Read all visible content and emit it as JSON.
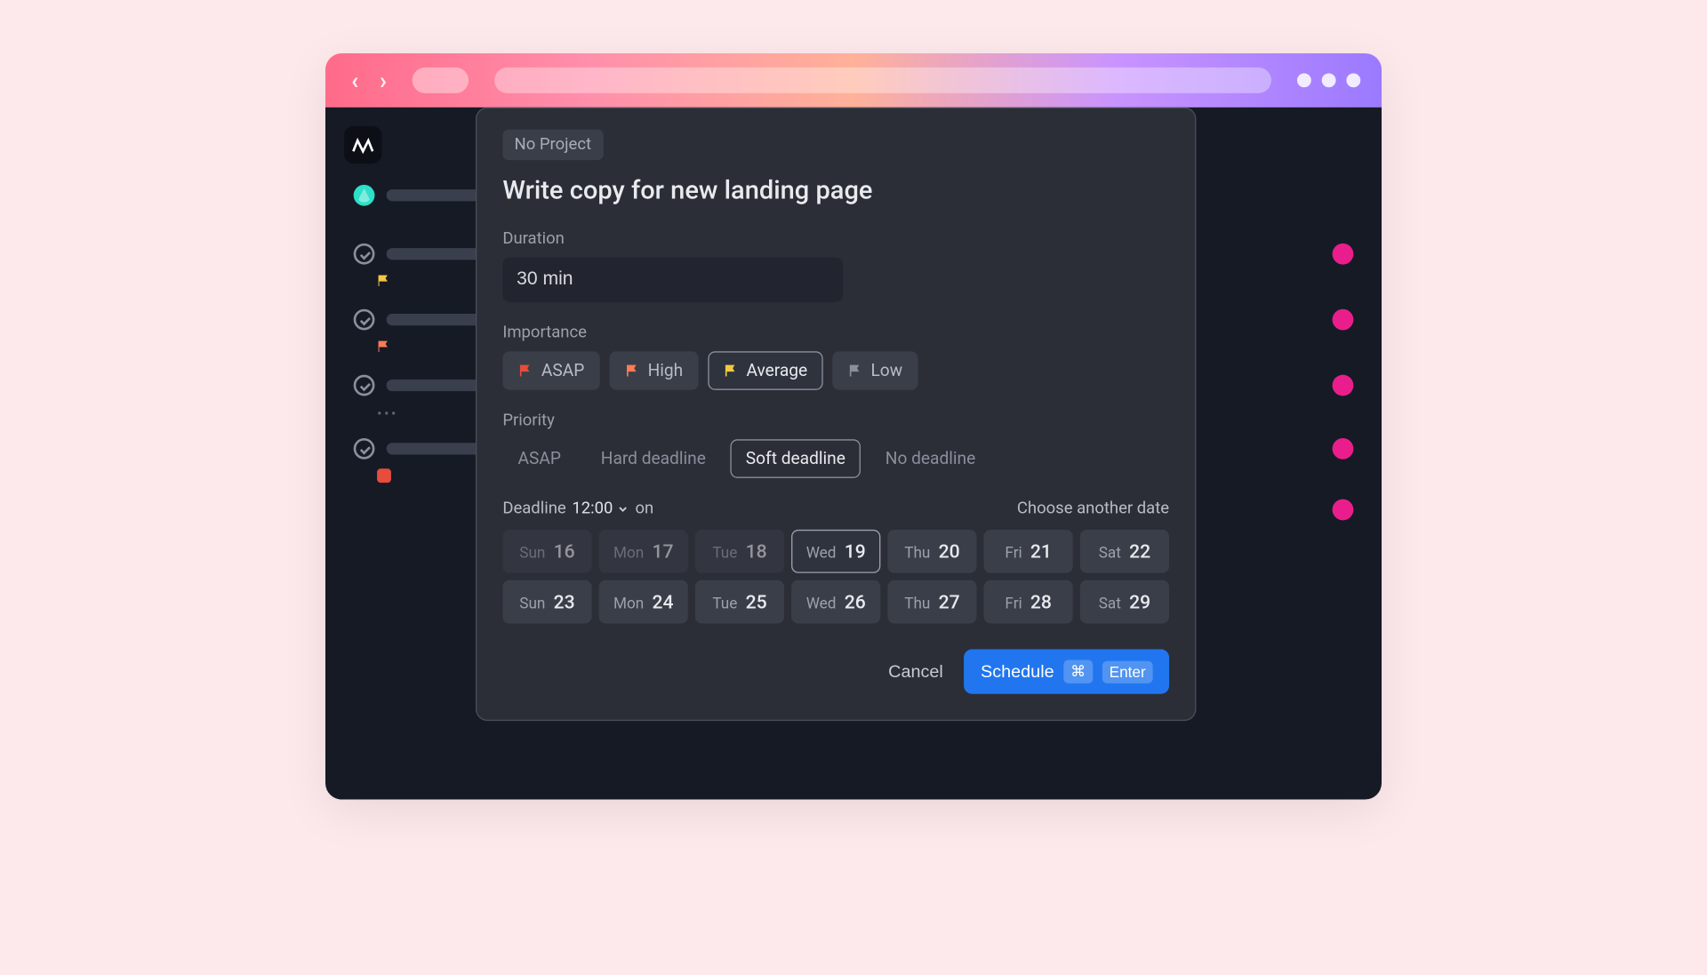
{
  "modal": {
    "project_chip": "No Project",
    "task_title": "Write copy for new landing page",
    "duration_label": "Duration",
    "duration_value": "30 min",
    "importance_label": "Importance",
    "importance_options": [
      {
        "label": "ASAP",
        "color": "#e74c3c",
        "selected": false
      },
      {
        "label": "High",
        "color": "#ff7b54",
        "selected": false
      },
      {
        "label": "Average",
        "color": "#f5c842",
        "selected": true
      },
      {
        "label": "Low",
        "color": "#8a8f9c",
        "selected": false
      }
    ],
    "priority_label": "Priority",
    "priority_options": [
      {
        "label": "ASAP",
        "selected": false
      },
      {
        "label": "Hard deadline",
        "selected": false
      },
      {
        "label": "Soft deadline",
        "selected": true
      },
      {
        "label": "No deadline",
        "selected": false
      }
    ],
    "deadline_prefix": "Deadline",
    "deadline_time": "12:00",
    "deadline_on": "on",
    "choose_another": "Choose another date",
    "dates": [
      {
        "dow": "Sun",
        "num": "16",
        "past": true,
        "selected": false
      },
      {
        "dow": "Mon",
        "num": "17",
        "past": true,
        "selected": false
      },
      {
        "dow": "Tue",
        "num": "18",
        "past": true,
        "selected": false
      },
      {
        "dow": "Wed",
        "num": "19",
        "past": false,
        "selected": true
      },
      {
        "dow": "Thu",
        "num": "20",
        "past": false,
        "selected": false
      },
      {
        "dow": "Fri",
        "num": "21",
        "past": false,
        "selected": false
      },
      {
        "dow": "Sat",
        "num": "22",
        "past": false,
        "selected": false
      },
      {
        "dow": "Sun",
        "num": "23",
        "past": false,
        "selected": false
      },
      {
        "dow": "Mon",
        "num": "24",
        "past": false,
        "selected": false
      },
      {
        "dow": "Tue",
        "num": "25",
        "past": false,
        "selected": false
      },
      {
        "dow": "Wed",
        "num": "26",
        "past": false,
        "selected": false
      },
      {
        "dow": "Thu",
        "num": "27",
        "past": false,
        "selected": false
      },
      {
        "dow": "Fri",
        "num": "28",
        "past": false,
        "selected": false
      },
      {
        "dow": "Sat",
        "num": "29",
        "past": false,
        "selected": false
      }
    ],
    "cancel_label": "Cancel",
    "schedule_label": "Schedule",
    "shortcut_mod": "⌘",
    "shortcut_key": "Enter"
  }
}
